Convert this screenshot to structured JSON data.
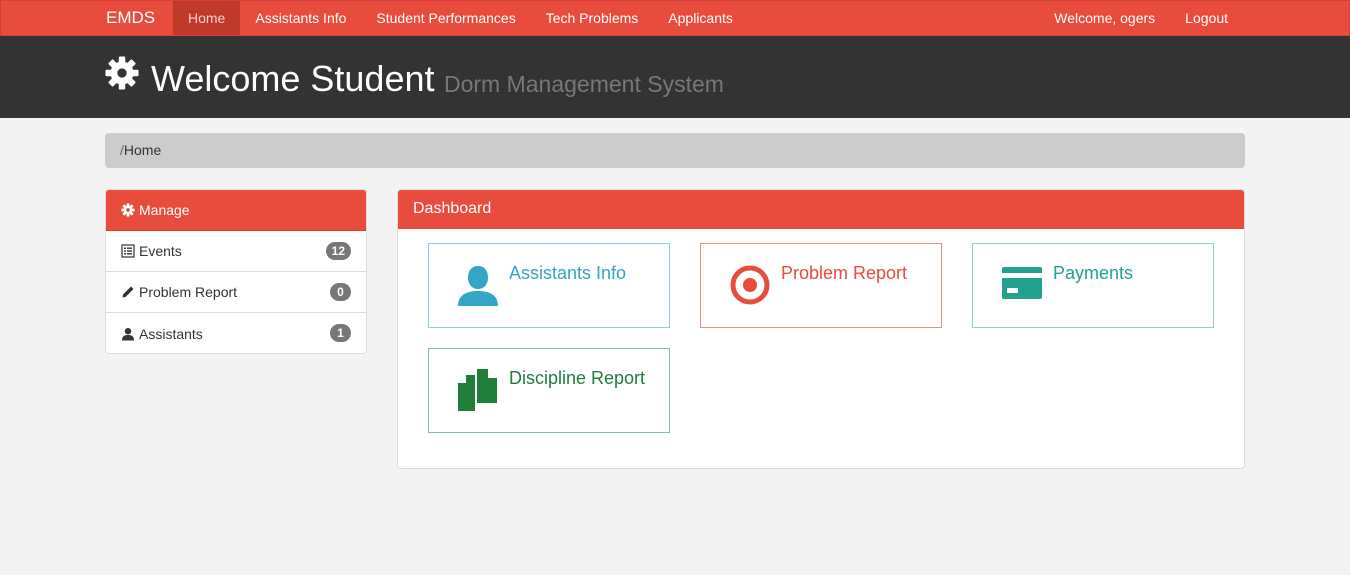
{
  "navbar": {
    "brand": "EMDS",
    "items": [
      {
        "label": "Home",
        "active": true
      },
      {
        "label": "Assistants Info"
      },
      {
        "label": "Student Performances"
      },
      {
        "label": "Tech Problems"
      },
      {
        "label": "Applicants"
      }
    ],
    "welcome": "Welcome, ogers",
    "logout": "Logout"
  },
  "header": {
    "icon": "gear-icon",
    "title": "Welcome Student",
    "subtitle": "Dorm Management System"
  },
  "breadcrumb": {
    "separator": "/",
    "current": "Home"
  },
  "sidebar": {
    "title": "Manage",
    "title_icon": "gear-icon",
    "items": [
      {
        "label": "Events",
        "count": "12",
        "icon": "list-icon"
      },
      {
        "label": "Problem Report",
        "count": "0",
        "icon": "pencil-icon"
      },
      {
        "label": "Assistants",
        "count": "1",
        "icon": "user-icon"
      }
    ]
  },
  "dashboard": {
    "title": "Dashboard",
    "cards": [
      {
        "label": "Assistants Info",
        "icon": "user-icon",
        "color": "#35a4c5"
      },
      {
        "label": "Problem Report",
        "icon": "target-icon",
        "color": "#e74c3c"
      },
      {
        "label": "Payments",
        "icon": "credit-card-icon",
        "color": "#24a08f"
      },
      {
        "label": "Discipline Report",
        "icon": "documents-icon",
        "color": "#1e7e3a"
      }
    ]
  },
  "colors": {
    "accent": "#e74c3c",
    "header_bg": "#333333"
  }
}
